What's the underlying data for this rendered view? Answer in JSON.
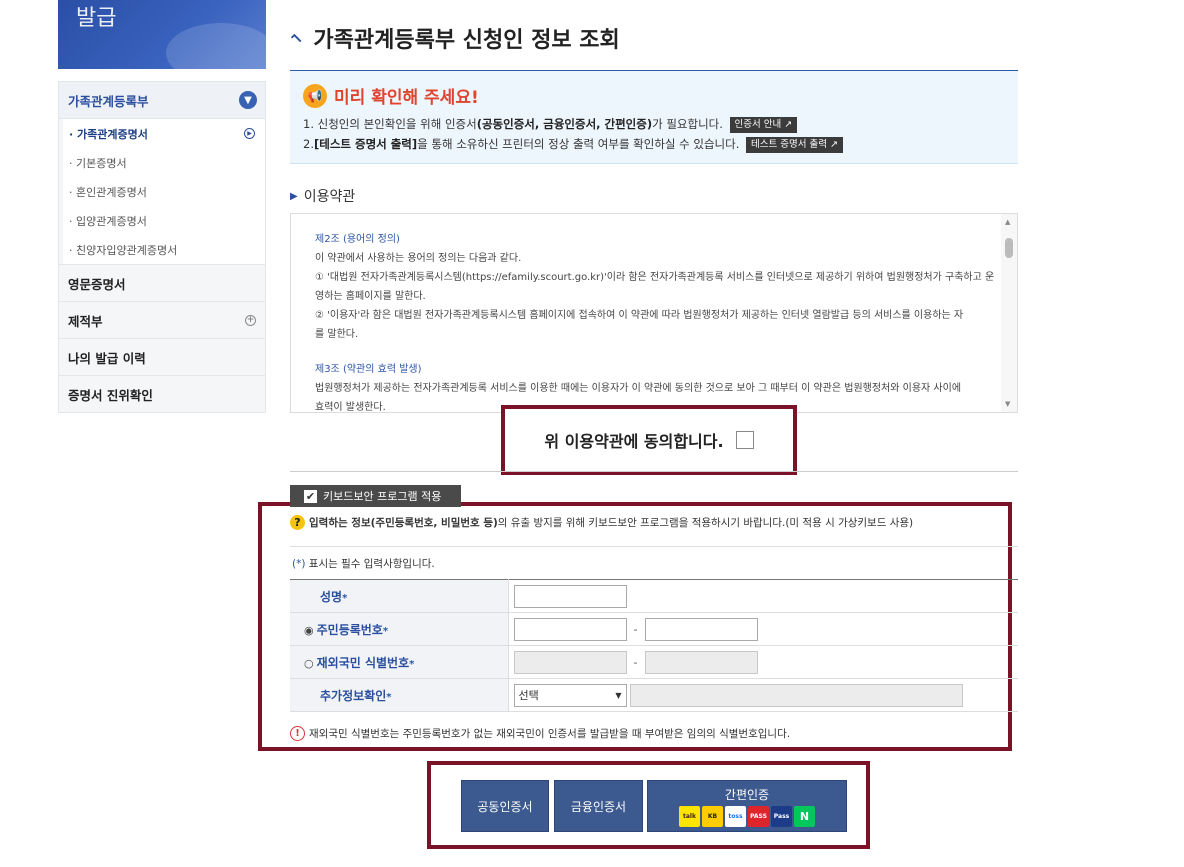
{
  "sidebar": {
    "banner_text": "발급",
    "head": "가족관계등록부",
    "sub_items": [
      "가족관계증명서",
      "기본증명서",
      "혼인관계증명서",
      "입양관계증명서",
      "친양자입양관계증명서"
    ],
    "items": [
      "영문증명서",
      "제적부",
      "나의 발급 이력",
      "증명서 진위확인"
    ]
  },
  "page_title": "가족관계등록부 신청인 정보 조회",
  "notice": {
    "heading": "미리 확인해 주세요!",
    "line1_a": "1. 신청인의 본인확인을 위해 인증서",
    "line1_b": "(공동인증서, 금융인증서, 간편인증)",
    "line1_c": "가 필요합니다.",
    "chip1": "인증서 안내 ↗",
    "line2_a": "2.",
    "line2_b": "[테스트 증명서 출력]",
    "line2_c": "을 통해 소유하신 프린터의 정상 출력 여부를 확인하실 수 있습니다.",
    "chip2": "테스트 증명서 출력 ↗"
  },
  "terms": {
    "section_title": "이용약관",
    "art2_title": "제2조 (용어의 정의)",
    "art2_l1": "이 약관에서 사용하는 용어의 정의는 다음과 같다.",
    "art2_l2": "① '대법원 전자가족관계등록시스템(https://efamily.scourt.go.kr)'이라 함은 전자가족관계등록 서비스를 인터넷으로 제공하기 위하여 법원행정처가 구축하고 운",
    "art2_l3": "영하는 홈페이지를 말한다.",
    "art2_l4": "② '이용자'라 함은 대법원 전자가족관계등록시스템 홈페이지에 접속하여 이 약관에 따라 법원행정처가 제공하는 인터넷 열람발급 등의 서비스를 이용하는 자",
    "art2_l5": "를 말한다.",
    "art3_title": "제3조 (약관의 효력 발생)",
    "art3_l1": "법원행정처가 제공하는 전자가족관계등록 서비스를 이용한 때에는 이용자가 이 약관에 동의한 것으로 보아 그 때부터 이 약관은 법원행정처와 이용자 사이에",
    "art3_l2": "효력이 발생한다.",
    "agree_label": "위 이용약관에 동의합니다."
  },
  "form": {
    "keyboard_button": "키보드보안 프로그램 적용",
    "keyboard_notice_a": "입력하는 정보",
    "keyboard_notice_b": "(주민등록번호, 비밀번호 등)",
    "keyboard_notice_c": "의 유출 방지를 위해 키보드보안 프로그램을 적용하시기 바랍니다.(미 적용 시 가상키보드 사용)",
    "required_star": "(*)",
    "required_note": " 표시는 필수 입력사항입니다.",
    "name_label": "성명",
    "rrn_label": "주민등록번호",
    "foreign_label": "재외국민 식별번호",
    "extra_label": "추가정보확인",
    "star": "*",
    "radio_on": "◉",
    "radio_off": "○",
    "dash": "-",
    "select_value": "선택",
    "footnote": "재외국민 식별번호는 주민등록번호가 없는 재외국민이 인증서를 발급받을 때 부여받은 임의의 식별번호입니다."
  },
  "auth": {
    "joint_cert": "공동인증서",
    "finance_cert": "금융인증서",
    "simple_auth": "간편인증",
    "logos": [
      "talk",
      "KB",
      "toss",
      "PASS",
      "Pass",
      "N"
    ]
  },
  "colors": {
    "accent": "#2b4f9e",
    "highlight_frame": "#7b1228",
    "button": "#3c5a8f",
    "notice_red": "#e0442e"
  }
}
